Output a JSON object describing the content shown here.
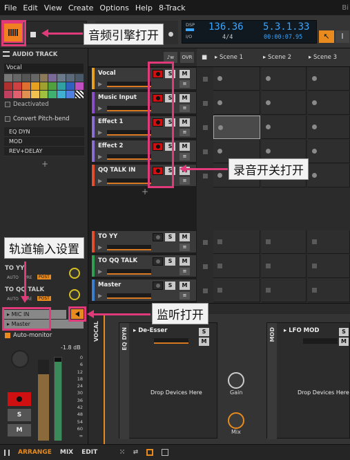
{
  "menu": {
    "items": [
      "File",
      "Edit",
      "View",
      "Create",
      "Options",
      "Help",
      "8-Track"
    ],
    "right": "Bi"
  },
  "transport": {
    "tempo": "136.36",
    "signature": "4/4",
    "position": "5.3.1.33",
    "time": "00:00:07.95",
    "dsp": "DSP",
    "io": "I/O"
  },
  "inspector": {
    "title": "AUDIO TRACK",
    "track_name": "Vocal",
    "deactivated": "Deactivated",
    "convert": "Convert Pitch-bend",
    "effects": [
      "EQ DYN",
      "MOD",
      "REV+DELAY"
    ],
    "add": "+",
    "sends": [
      {
        "name": "TO YY",
        "modes": [
          "AUTO",
          "PRE",
          "POST"
        ]
      },
      {
        "name": "TO QQ TALK",
        "modes": [
          "AUTO",
          "PRE",
          "POST"
        ]
      }
    ],
    "input": "MIC IN",
    "output": "Master",
    "automonitor": "Auto-monitor",
    "level": "-1.8 dB",
    "scale": [
      "0",
      "6",
      "12",
      "18",
      "24",
      "30",
      "36",
      "42",
      "48",
      "54",
      "60",
      "∞"
    ],
    "solo": "S",
    "mute": "M"
  },
  "tracks": [
    {
      "name": "Vocal",
      "color": "#e8a020"
    },
    {
      "name": "Music Input",
      "color": "#8a4fc8"
    },
    {
      "name": "Effect 1",
      "color": "#8a6fd0"
    },
    {
      "name": "Effect 2",
      "color": "#8a6fd0"
    },
    {
      "name": "QQ TALK IN",
      "color": "#e05030"
    }
  ],
  "fx_tracks": [
    {
      "name": "TO YY",
      "color": "#e05030"
    },
    {
      "name": "TO QQ TALK",
      "color": "#30a050"
    },
    {
      "name": "Master",
      "color": "#3a7fd0"
    }
  ],
  "track_buttons": {
    "solo": "S",
    "mute": "M",
    "ovr": "OVR",
    "add": "+"
  },
  "scenes": [
    "Scene 1",
    "Scene 2",
    "Scene 3"
  ],
  "devices": {
    "track_label": "VOCAL",
    "chain1": "EQ DYN",
    "dev1": "De-Esser",
    "drop": "Drop Devices Here",
    "gain": "Gain",
    "mix": "Mix",
    "chain2": "MOD",
    "dev2": "LFO MOD",
    "drop2": "Drop Devices Here",
    "solo": "S",
    "mute": "M"
  },
  "bottom": {
    "arrange": "ARRANGE",
    "mix": "MIX",
    "edit": "EDIT"
  },
  "annotations": {
    "engine": "音频引擎打开",
    "record": "录音开关打开",
    "input": "轨道输入设置",
    "monitor": "监听打开"
  },
  "colors": {
    "accent": "#e88a1e",
    "annotation": "#e03a7a",
    "record": "#d01010"
  }
}
